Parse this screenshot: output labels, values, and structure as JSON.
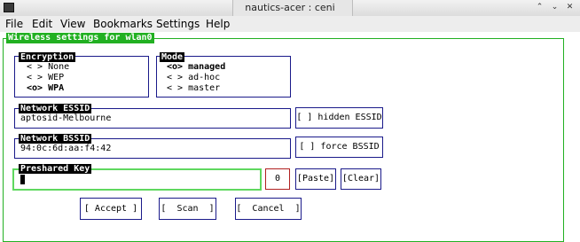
{
  "window": {
    "title": "nautics-acer : ceni",
    "controls": [
      "⌃",
      "⌄",
      "✕"
    ]
  },
  "menu": [
    "File",
    "Edit",
    "View",
    "Bookmarks",
    "Settings",
    "Help"
  ],
  "dialog": {
    "title": "Wireless settings for wlan0",
    "encryption": {
      "label": "Encryption",
      "options": [
        {
          "text": "< > None"
        },
        {
          "text": "< > WEP"
        },
        {
          "text": "<o> WPA"
        }
      ]
    },
    "mode": {
      "label": "Mode",
      "options": [
        {
          "text": "<o> managed"
        },
        {
          "text": "< > ad-hoc"
        },
        {
          "text": "< > master"
        }
      ]
    },
    "essid": {
      "label": "Network ESSID",
      "value": "aptosid-Melbourne",
      "checkbox": "[ ] hidden ESSID"
    },
    "bssid": {
      "label": "Network BSSID",
      "value": "94:0c:6d:aa:f4:42",
      "checkbox": "[ ] force BSSID"
    },
    "psk": {
      "label": "Preshared Key",
      "value": "",
      "count": "0",
      "paste": "[Paste]",
      "clear": "[Clear]"
    },
    "buttons": {
      "accept": "[ Accept ]",
      "scan": "[  Scan  ]",
      "cancel": "[  Cancel  ]"
    }
  },
  "colors": {
    "accent_green": "#22b022",
    "border_blue": "#1a1a8a",
    "count_border_red": "#b02020"
  }
}
